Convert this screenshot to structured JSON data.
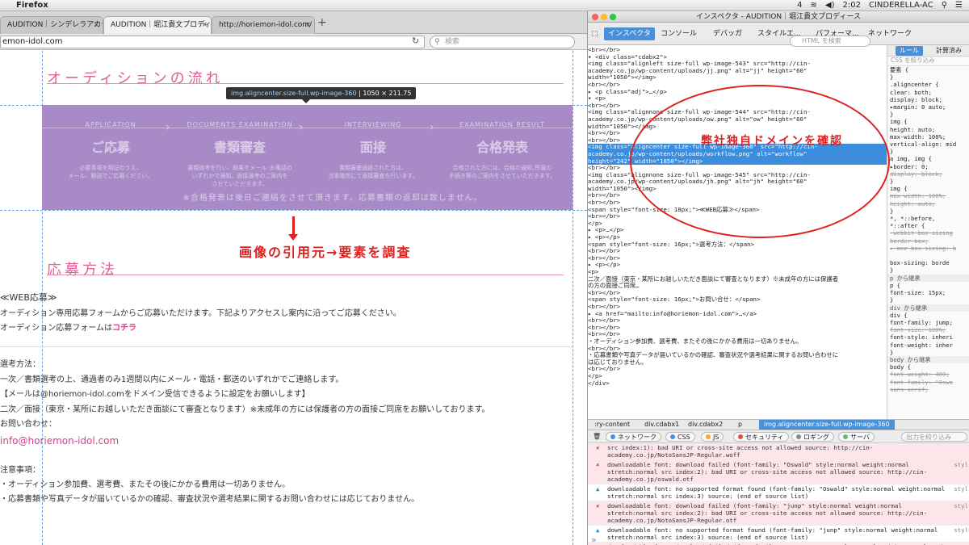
{
  "menubar": {
    "app": "Firefox",
    "clock": "2:02",
    "user": "CINDERELLA-AC",
    "battery": "4"
  },
  "browser": {
    "tabs": [
      {
        "label": "AUDITION｜シンデレラアカデ…"
      },
      {
        "label": "AUDITION｜堀江貴文プロディース"
      },
      {
        "label": "http://horiemon-idol.com/"
      }
    ],
    "url": "emon-idol.com",
    "search_placeholder": "検索"
  },
  "page": {
    "section1_title": "オーディションの流れ",
    "tooltip_tag": "img.aligncenter.size-full.wp-image-360",
    "tooltip_size": "1050 × 211.75",
    "flow": {
      "steps": [
        {
          "en": "APPLICATION",
          "jp": "ご応募",
          "desc1": "必要事項を明記のうえ、",
          "desc2": "メール、郵送でご応募ください。",
          "desc3": ""
        },
        {
          "en": "DOCUMENTS EXAMINATION",
          "jp": "書類審査",
          "desc1": "書類選考を行い、結果をメール･お電話の",
          "desc2": "いずれかで通知。面接選考のご案内を",
          "desc3": "させていただきます。"
        },
        {
          "en": "INTERVIEWING",
          "jp": "面接",
          "desc1": "書類審査通過された方は、",
          "desc2": "当事務所にて面接審査を行います。",
          "desc3": ""
        },
        {
          "en": "EXAMINATION RESULT",
          "jp": "合格発表",
          "desc1": "合格された方には、合格の通知､所属の",
          "desc2": "手続き等のご案内をさせていただきます。",
          "desc3": ""
        }
      ],
      "note": "※合格発表は後日ご連絡をさせて頂きます。応募書類の返却は致しません。"
    },
    "annotation_left": "画像の引用元→要素を調査",
    "section2_title": "応募方法",
    "web_heading": "≪WEB応募≫",
    "web_text": "オーディション専用応募フォームからご応募いただけます。下記よりアクセスし案内に沿ってご応募ください。",
    "form_text": "オーディション応募フォームは",
    "form_link": "コチラ",
    "select_heading": "選考方法：",
    "select_line1": "一次／書類選考の上、通過者のみ1週間以内にメール・電話・郵送のいずれかでご連絡します。",
    "select_line2": "【メールは@horiemon-idol.comをドメイン受信できるように設定をお願いします】",
    "select_line3": "二次／面接（東京・某所にお越しいただき面談にて審査となります）※未成年の方には保護者の方の面接ご同席をお願いしております。",
    "contact_heading": "お問い合わせ：",
    "contact_email": "info@horiemon-idol.com",
    "notes_heading": "注意事項：",
    "notes_line1": "・オーディション参加費、選考費、またその後にかかる費用は一切ありません。",
    "notes_line2": "・応募書類や写真データが届いているかの確認、審査状況や選考結果に関するお問い合わせには応じておりません。"
  },
  "devtools": {
    "title": "インスペクタ - AUDITION｜堀江貴文プロディース",
    "tabs": [
      "インスペクタ",
      "コンソール",
      "デバッガ",
      "スタイルエ...",
      "パフォーマ...",
      "ネットワーク"
    ],
    "html_search_placeholder": "HTML を検索",
    "annotation": "弊社独自ドメインを確認",
    "markup": [
      {
        "text": "  <br></br>",
        "sel": false
      },
      {
        "text": "▾ <div class=\"cdabx2\">",
        "sel": false
      },
      {
        "text": "    <img class=\"alignleft size-full wp-image-543\" src=\"http://cin-",
        "sel": false
      },
      {
        "text": "    academy.co.jp/wp-content/uploads/jj.png\" alt=\"jj\" height=\"60\"",
        "sel": false
      },
      {
        "text": "    width=\"1050\"></img>",
        "sel": false
      },
      {
        "text": "    <br></br>",
        "sel": false
      },
      {
        "text": "  ▸ <p class=\"adj\">…</p>",
        "sel": false
      },
      {
        "text": "  ▾ <p>",
        "sel": false
      },
      {
        "text": "      <br></br>",
        "sel": false
      },
      {
        "text": "      <img class=\"alignnone size-full wp-image-544\" src=\"http://cin-",
        "sel": false
      },
      {
        "text": "      academy.co.jp/wp-content/uploads/ow.png\" alt=\"ow\" height=\"60\"",
        "sel": false
      },
      {
        "text": "      width=\"1050\"></img>",
        "sel": false
      },
      {
        "text": "      <br></br>",
        "sel": false
      },
      {
        "text": "      <br></br>",
        "sel": false
      },
      {
        "text": "      <img class=\"aligncenter size-full wp-image-360\" src=\"http://cin-",
        "sel": true
      },
      {
        "text": "      academy.co.jp/wp-content/uploads/workflow.png\" alt=\"workflow\"",
        "sel": true
      },
      {
        "text": "      height=\"242\" width=\"1050\"></img>",
        "sel": true
      },
      {
        "text": "      <br></br>",
        "sel": false
      },
      {
        "text": "      <img class=\"alignnone size-full wp-image-545\" src=\"http://cin-",
        "sel": false
      },
      {
        "text": "      academy.co.jp/wp-content/uploads/jh.png\" alt=\"jh\" height=\"60\"",
        "sel": false
      },
      {
        "text": "      width=\"1050\"></img>",
        "sel": false
      },
      {
        "text": "      <br></br>",
        "sel": false
      },
      {
        "text": "      <br></br>",
        "sel": false
      },
      {
        "text": "      <span style=\"font-size: 18px;\">≪WEB応募≫</span>",
        "sel": false
      },
      {
        "text": "      <br></br>",
        "sel": false
      },
      {
        "text": "    </p>",
        "sel": false
      },
      {
        "text": "  ▸ <p>…</p>",
        "sel": false
      },
      {
        "text": "  ▸ <p></p>",
        "sel": false
      },
      {
        "text": "    <span style=\"font-size: 16px;\">選考方法：</span>",
        "sel": false
      },
      {
        "text": "    <br></br>",
        "sel": false
      },
      {
        "text": "    <br></br>",
        "sel": false
      },
      {
        "text": "  ▸ <p></p>",
        "sel": false
      },
      {
        "text": "    <p>",
        "sel": false
      },
      {
        "text": "    二次／面接（東京・某所にお越しいただき面談にて審査となります）※未成年の方には保護者",
        "sel": false
      },
      {
        "text": "    の方の面接ご同席…",
        "sel": false
      },
      {
        "text": "    <br></br>",
        "sel": false
      },
      {
        "text": "    <span style=\"font-size: 16px;\">お問い合せ：</span>",
        "sel": false
      },
      {
        "text": "    <br></br>",
        "sel": false
      },
      {
        "text": "  ▸ <a href=\"mailto:info@horiemon-idol.com\">…</a>",
        "sel": false
      },
      {
        "text": "    <br></br>",
        "sel": false
      },
      {
        "text": "    <br></br>",
        "sel": false
      },
      {
        "text": "    <br></br>",
        "sel": false
      },
      {
        "text": "    ・オーディション参加費、選考費、またその後にかかる費用は一切ありません。",
        "sel": false
      },
      {
        "text": "    <br></br>",
        "sel": false
      },
      {
        "text": "    ・応募書類や写真データが届いているかの確認、審査状況や選考結果に関するお問い合わせに",
        "sel": false
      },
      {
        "text": "    は応じておりません。",
        "sel": false
      },
      {
        "text": "    <br></br>",
        "sel": false
      },
      {
        "text": "  </p>",
        "sel": false
      },
      {
        "text": "</div>",
        "sel": false
      }
    ],
    "rules_tabs": [
      "ルール",
      "計算済み"
    ],
    "rules_filter": "CSS を絞り込み",
    "rules": [
      {
        "text": "要素 {",
        "cls": ""
      },
      {
        "text": "}",
        "cls": ""
      },
      {
        "text": ".aligncenter {",
        "cls": ""
      },
      {
        "text": "  clear: both;",
        "cls": ""
      },
      {
        "text": "  display: block;",
        "cls": ""
      },
      {
        "text": " ▸margin: 0 auto;",
        "cls": ""
      },
      {
        "text": "}",
        "cls": ""
      },
      {
        "text": "img {",
        "cls": ""
      },
      {
        "text": "  height: auto;",
        "cls": ""
      },
      {
        "text": "  max-width: 100%;",
        "cls": ""
      },
      {
        "text": "  vertical-align: mid",
        "cls": ""
      },
      {
        "text": "}",
        "cls": ""
      },
      {
        "text": "a img, img {",
        "cls": ""
      },
      {
        "text": " ▸border: 0;",
        "cls": ""
      },
      {
        "text": "  display: block;",
        "cls": "strike"
      },
      {
        "text": "}",
        "cls": ""
      },
      {
        "text": "img {",
        "cls": ""
      },
      {
        "text": "  max-width: 100%;",
        "cls": "strike"
      },
      {
        "text": "  height: auto;",
        "cls": "strike"
      },
      {
        "text": "}",
        "cls": ""
      },
      {
        "text": "*, *::before, ",
        "cls": ""
      },
      {
        "text": "*::after {",
        "cls": ""
      },
      {
        "text": "  -webkit-box-sizing",
        "cls": "strike"
      },
      {
        "text": "border-box;",
        "cls": "strike"
      },
      {
        "text": " ▸-moz-box-sizing: b",
        "cls": "strike"
      },
      {
        "text": "",
        "cls": ""
      },
      {
        "text": "  box-sizing: borde",
        "cls": ""
      },
      {
        "text": "}",
        "cls": ""
      },
      {
        "text": "p から継承",
        "cls": "head"
      },
      {
        "text": "p {",
        "cls": ""
      },
      {
        "text": "  font-size: 15px;",
        "cls": ""
      },
      {
        "text": "}",
        "cls": ""
      },
      {
        "text": "div から継承",
        "cls": "head"
      },
      {
        "text": "div {",
        "cls": ""
      },
      {
        "text": "  font-family: jump;",
        "cls": ""
      },
      {
        "text": "  font-size: 100%;",
        "cls": "strike"
      },
      {
        "text": "  font-style: inheri",
        "cls": ""
      },
      {
        "text": "  font-weight: inher",
        "cls": ""
      },
      {
        "text": "}",
        "cls": ""
      },
      {
        "text": "body から継承",
        "cls": "head"
      },
      {
        "text": "body {",
        "cls": ""
      },
      {
        "text": "  font-weight: 400;",
        "cls": "strike"
      },
      {
        "text": "  font-family: \"Oswa",
        "cls": "strike"
      },
      {
        "text": "sans-serif;",
        "cls": "strike"
      }
    ],
    "breadcrumbs": [
      ":ry-content",
      "div.cdabx1",
      "div.cdabx2",
      "p",
      "img.aligncenter.size-full.wp-image-360"
    ],
    "console_filters": [
      {
        "label": "ネットワーク",
        "color": "#4a90d9"
      },
      {
        "label": "CSS",
        "color": "#4a90d9"
      },
      {
        "label": "JS",
        "color": "#e8b22b"
      },
      {
        "label": "セキュリティ",
        "color": "#e74c3c"
      },
      {
        "label": "ロギング",
        "color": "#888888"
      },
      {
        "label": "サーバ",
        "color": "#6cb86c"
      }
    ],
    "console_output_filter": "出力を絞り込み",
    "console": [
      {
        "type": "err",
        "icon": "×",
        "text": "src index:1): bad URI or cross-site access not allowed source: http://cin-academy.co.jp/NotoSansJP-Regular.woff",
        "src": ""
      },
      {
        "type": "err",
        "icon": "×",
        "text": "downloadable font: download failed (font-family: \"Oswald\" style:normal weight:normal stretch:normal src index:2): bad URI or cross-site access not allowed source: http://cin-academy.co.jp/oswald.otf",
        "src": "styl"
      },
      {
        "type": "warn",
        "icon": "▲",
        "text": "downloadable font: no supported format found (font-family: \"Oswald\" style:normal weight:normal stretch:normal src index:3) source: (end of source list)",
        "src": "styl"
      },
      {
        "type": "err",
        "icon": "×",
        "text": "downloadable font: download failed (font-family: \"junp\" style:normal weight:normal stretch:normal src index:2): bad URI or cross-site access not allowed source: http://cin-academy.co.jp/NotoSansJP-Regular.otf",
        "src": "styl"
      },
      {
        "type": "warn",
        "icon": "▲",
        "text": "downloadable font: no supported format found (font-family: \"junp\" style:normal weight:normal stretch:normal src index:3) source: (end of source list)",
        "src": "styl"
      },
      {
        "type": "err",
        "icon": "×",
        "text": "downloadable font: download failed (font-family: \"FontAwesome\" style:normal weight:normal stretch:normal src index:1): status=2147746065 source: http://horiemon-idol.com/fonts/fontawesome-",
        "src": "font-awe"
      }
    ]
  }
}
